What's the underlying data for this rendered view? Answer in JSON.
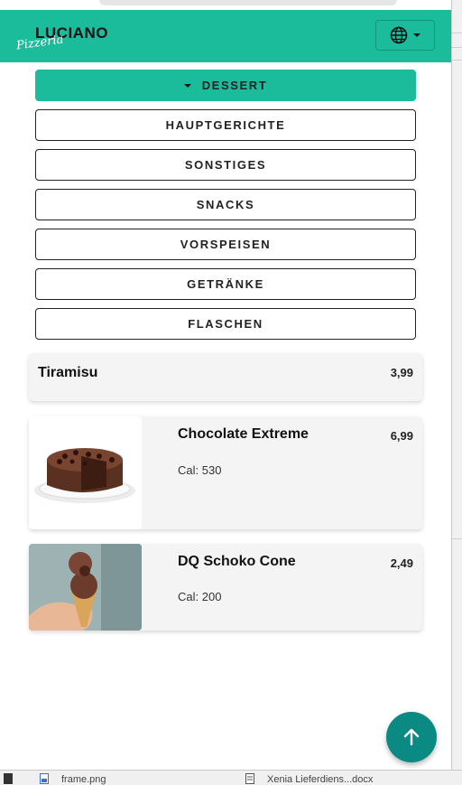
{
  "header": {
    "logo_main": "LUCIANO",
    "logo_script": "Pizzeria",
    "language_icon": "globe-icon"
  },
  "categories": [
    {
      "label": "DESSERT",
      "active": true
    },
    {
      "label": "HAUPTGERICHTE"
    },
    {
      "label": "SONSTIGES"
    },
    {
      "label": "SNACKS"
    },
    {
      "label": "VORSPEISEN"
    },
    {
      "label": "GETRÄNKE"
    },
    {
      "label": "FLASCHEN"
    }
  ],
  "items": [
    {
      "name": "Tiramisu",
      "price": "3,99"
    },
    {
      "name": "Chocolate Extreme",
      "price": "6,99",
      "calories": "Cal: 530"
    },
    {
      "name": "DQ Schoko Cone",
      "price": "2,49",
      "calories": "Cal: 200"
    }
  ],
  "background": {
    "taskbar_items": [
      "frame.png",
      "Xenia Lieferdiens...docx"
    ]
  },
  "colors": {
    "accent": "#1abc9c",
    "fab": "#0b8a83",
    "card_bg": "#f4f4f4"
  }
}
